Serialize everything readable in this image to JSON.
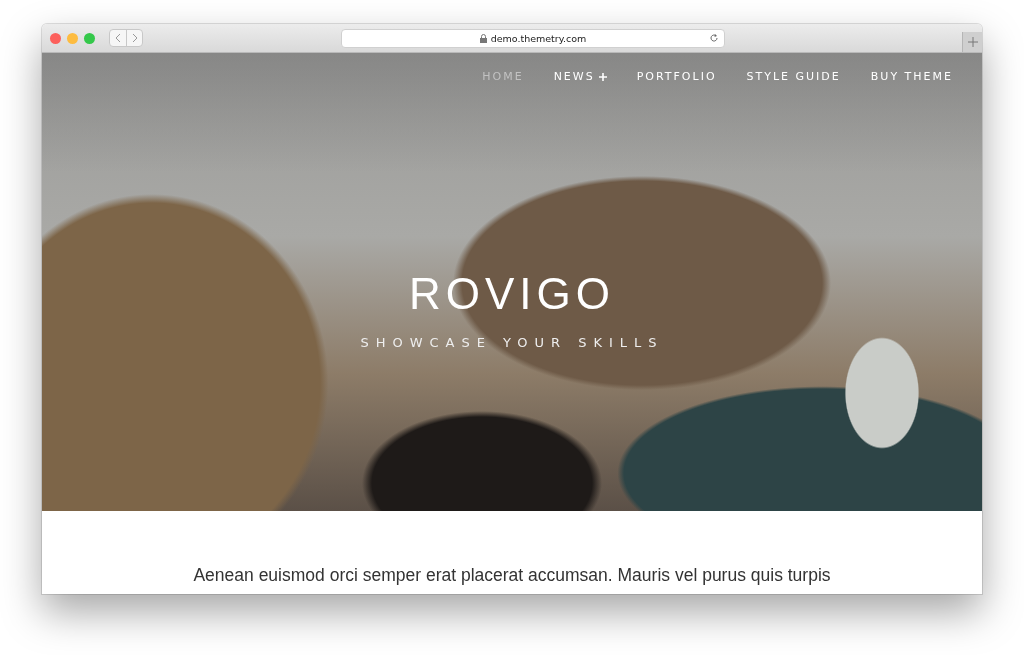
{
  "browser": {
    "url": "demo.themetry.com"
  },
  "nav": [
    {
      "label": "HOME",
      "selected": true,
      "has_submenu": false
    },
    {
      "label": "NEWS",
      "selected": false,
      "has_submenu": true
    },
    {
      "label": "PORTFOLIO",
      "selected": false,
      "has_submenu": false
    },
    {
      "label": "STYLE GUIDE",
      "selected": false,
      "has_submenu": false
    },
    {
      "label": "BUY THEME",
      "selected": false,
      "has_submenu": false
    }
  ],
  "hero": {
    "title": "ROVIGO",
    "tagline": "SHOWCASE YOUR SKILLS"
  },
  "intro": "Aenean euismod orci semper erat placerat accumsan. Mauris vel purus quis turpis"
}
